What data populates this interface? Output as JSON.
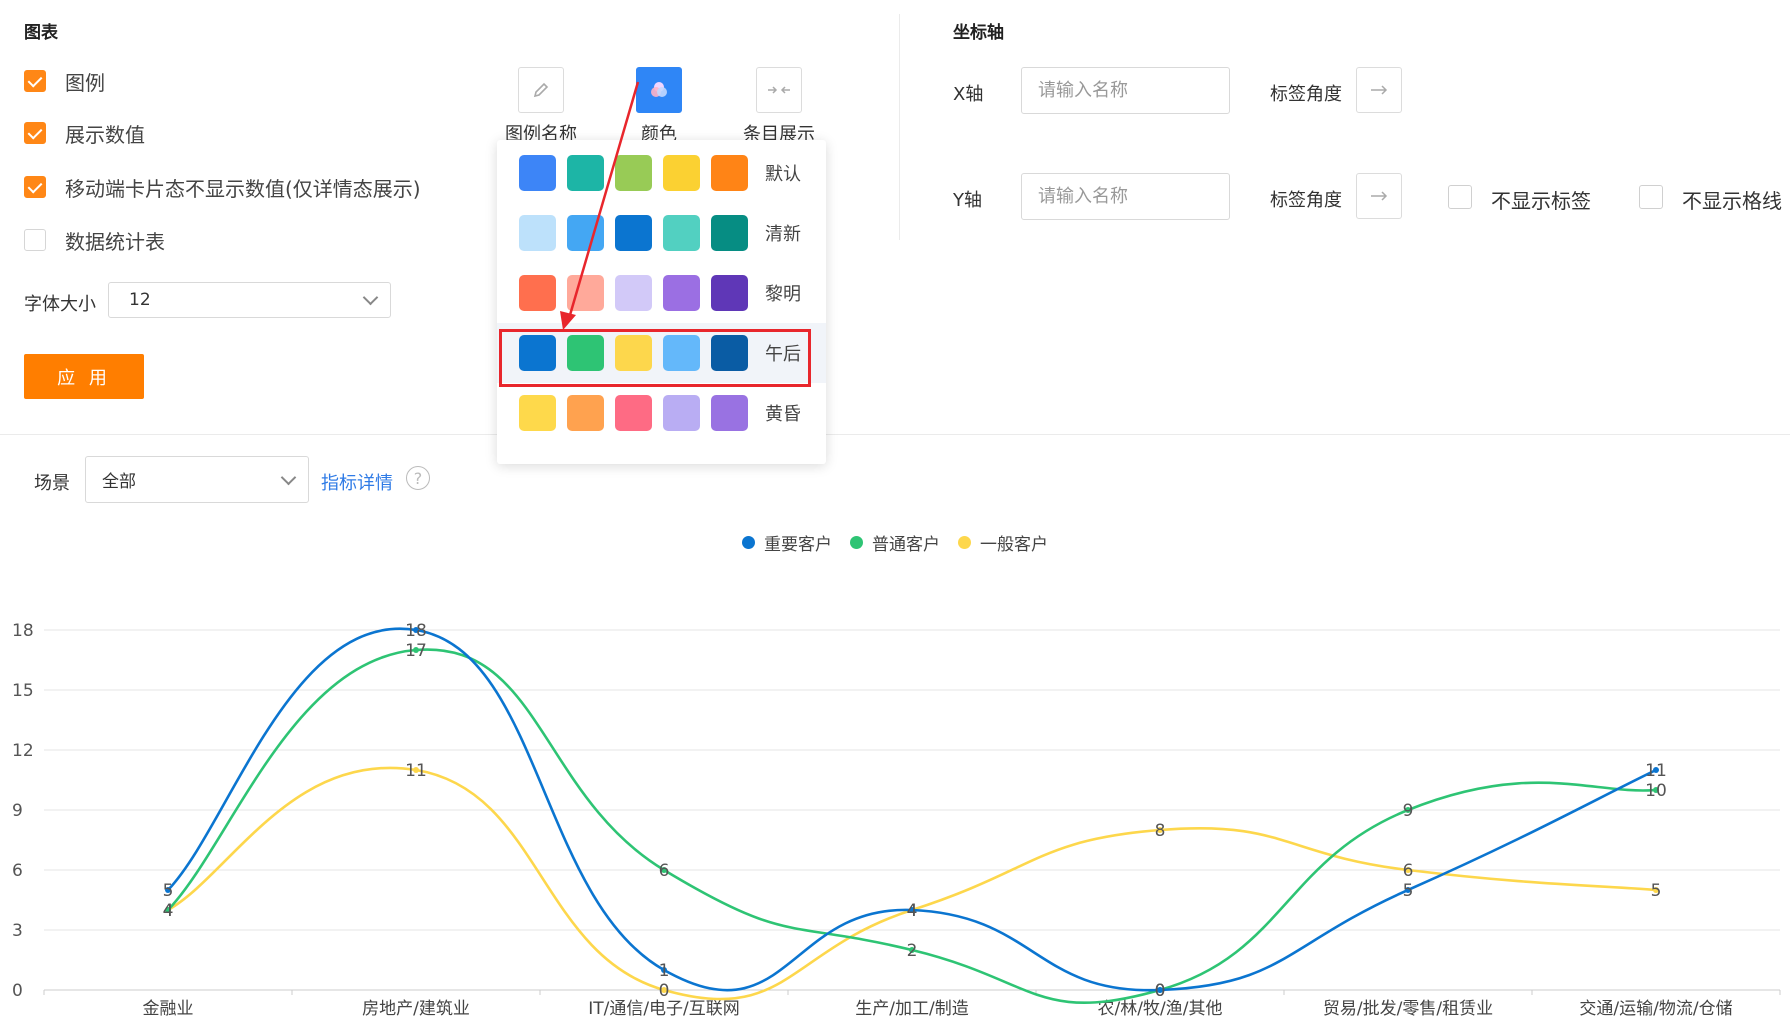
{
  "chart_section": {
    "title": "图表",
    "checkboxes": [
      {
        "label": "图例",
        "checked": true
      },
      {
        "label": "展示数值",
        "checked": true
      },
      {
        "label": "移动端卡片态不显示数值(仅详情态展示)",
        "checked": true
      },
      {
        "label": "数据统计表",
        "checked": false
      }
    ],
    "font_size_label": "字体大小",
    "font_size_value": "12",
    "apply_label": "应 用"
  },
  "toolbar": {
    "legend_name_label": "图例名称",
    "color_label": "颜色",
    "items_label": "条目展示"
  },
  "color_popup": {
    "schemes": [
      {
        "name": "默认",
        "colors": [
          "#3d85f7",
          "#1db5a6",
          "#98cb56",
          "#fbd132",
          "#ff8416"
        ]
      },
      {
        "name": "清新",
        "colors": [
          "#bde1fb",
          "#44a7f3",
          "#0b75d0",
          "#52d0c1",
          "#068d83"
        ]
      },
      {
        "name": "黎明",
        "colors": [
          "#ff6f4e",
          "#ffa99a",
          "#d2c9f8",
          "#9b6fe3",
          "#5f37b7"
        ]
      },
      {
        "name": "午后",
        "colors": [
          "#0b75d0",
          "#2ec474",
          "#fdd74c",
          "#64b8fa",
          "#0a5ca4"
        ]
      },
      {
        "name": "黄昏",
        "colors": [
          "#fed94b",
          "#ffa24f",
          "#fe6b84",
          "#b9adf3",
          "#9972e2"
        ]
      }
    ],
    "highlighted": "午后"
  },
  "axis_section": {
    "title": "坐标轴",
    "x_axis_label": "X轴",
    "y_axis_label": "Y轴",
    "name_placeholder": "请输入名称",
    "label_angle": "标签角度",
    "hide_labels": "不显示标签",
    "hide_gridlines": "不显示格线"
  },
  "filter": {
    "scene_label": "场景",
    "scene_value": "全部",
    "metric_detail_link": "指标详情",
    "help_symbol": "?"
  },
  "chart_data": {
    "type": "line",
    "categories": [
      "金融业",
      "房地产/建筑业",
      "IT/通信/电子/互联网",
      "生产/加工/制造",
      "农/林/牧/渔/其他",
      "贸易/批发/零售/租赁业",
      "交通/运输/物流/仓储"
    ],
    "series": [
      {
        "name": "重要客户",
        "color": "#0b75d0",
        "values": [
          5,
          18,
          1,
          4,
          0,
          5,
          11
        ]
      },
      {
        "name": "普通客户",
        "color": "#2ec474",
        "values": [
          4,
          17,
          6,
          2,
          0,
          9,
          10
        ]
      },
      {
        "name": "一般客户",
        "color": "#fdd74c",
        "values": [
          4,
          11,
          0,
          4,
          8,
          6,
          5
        ]
      }
    ],
    "yticks": [
      0,
      3,
      6,
      9,
      12,
      15,
      18
    ],
    "ylim": [
      0,
      18
    ],
    "smooth": true,
    "show_values": true,
    "grid": true,
    "legend_position": "top-center"
  }
}
